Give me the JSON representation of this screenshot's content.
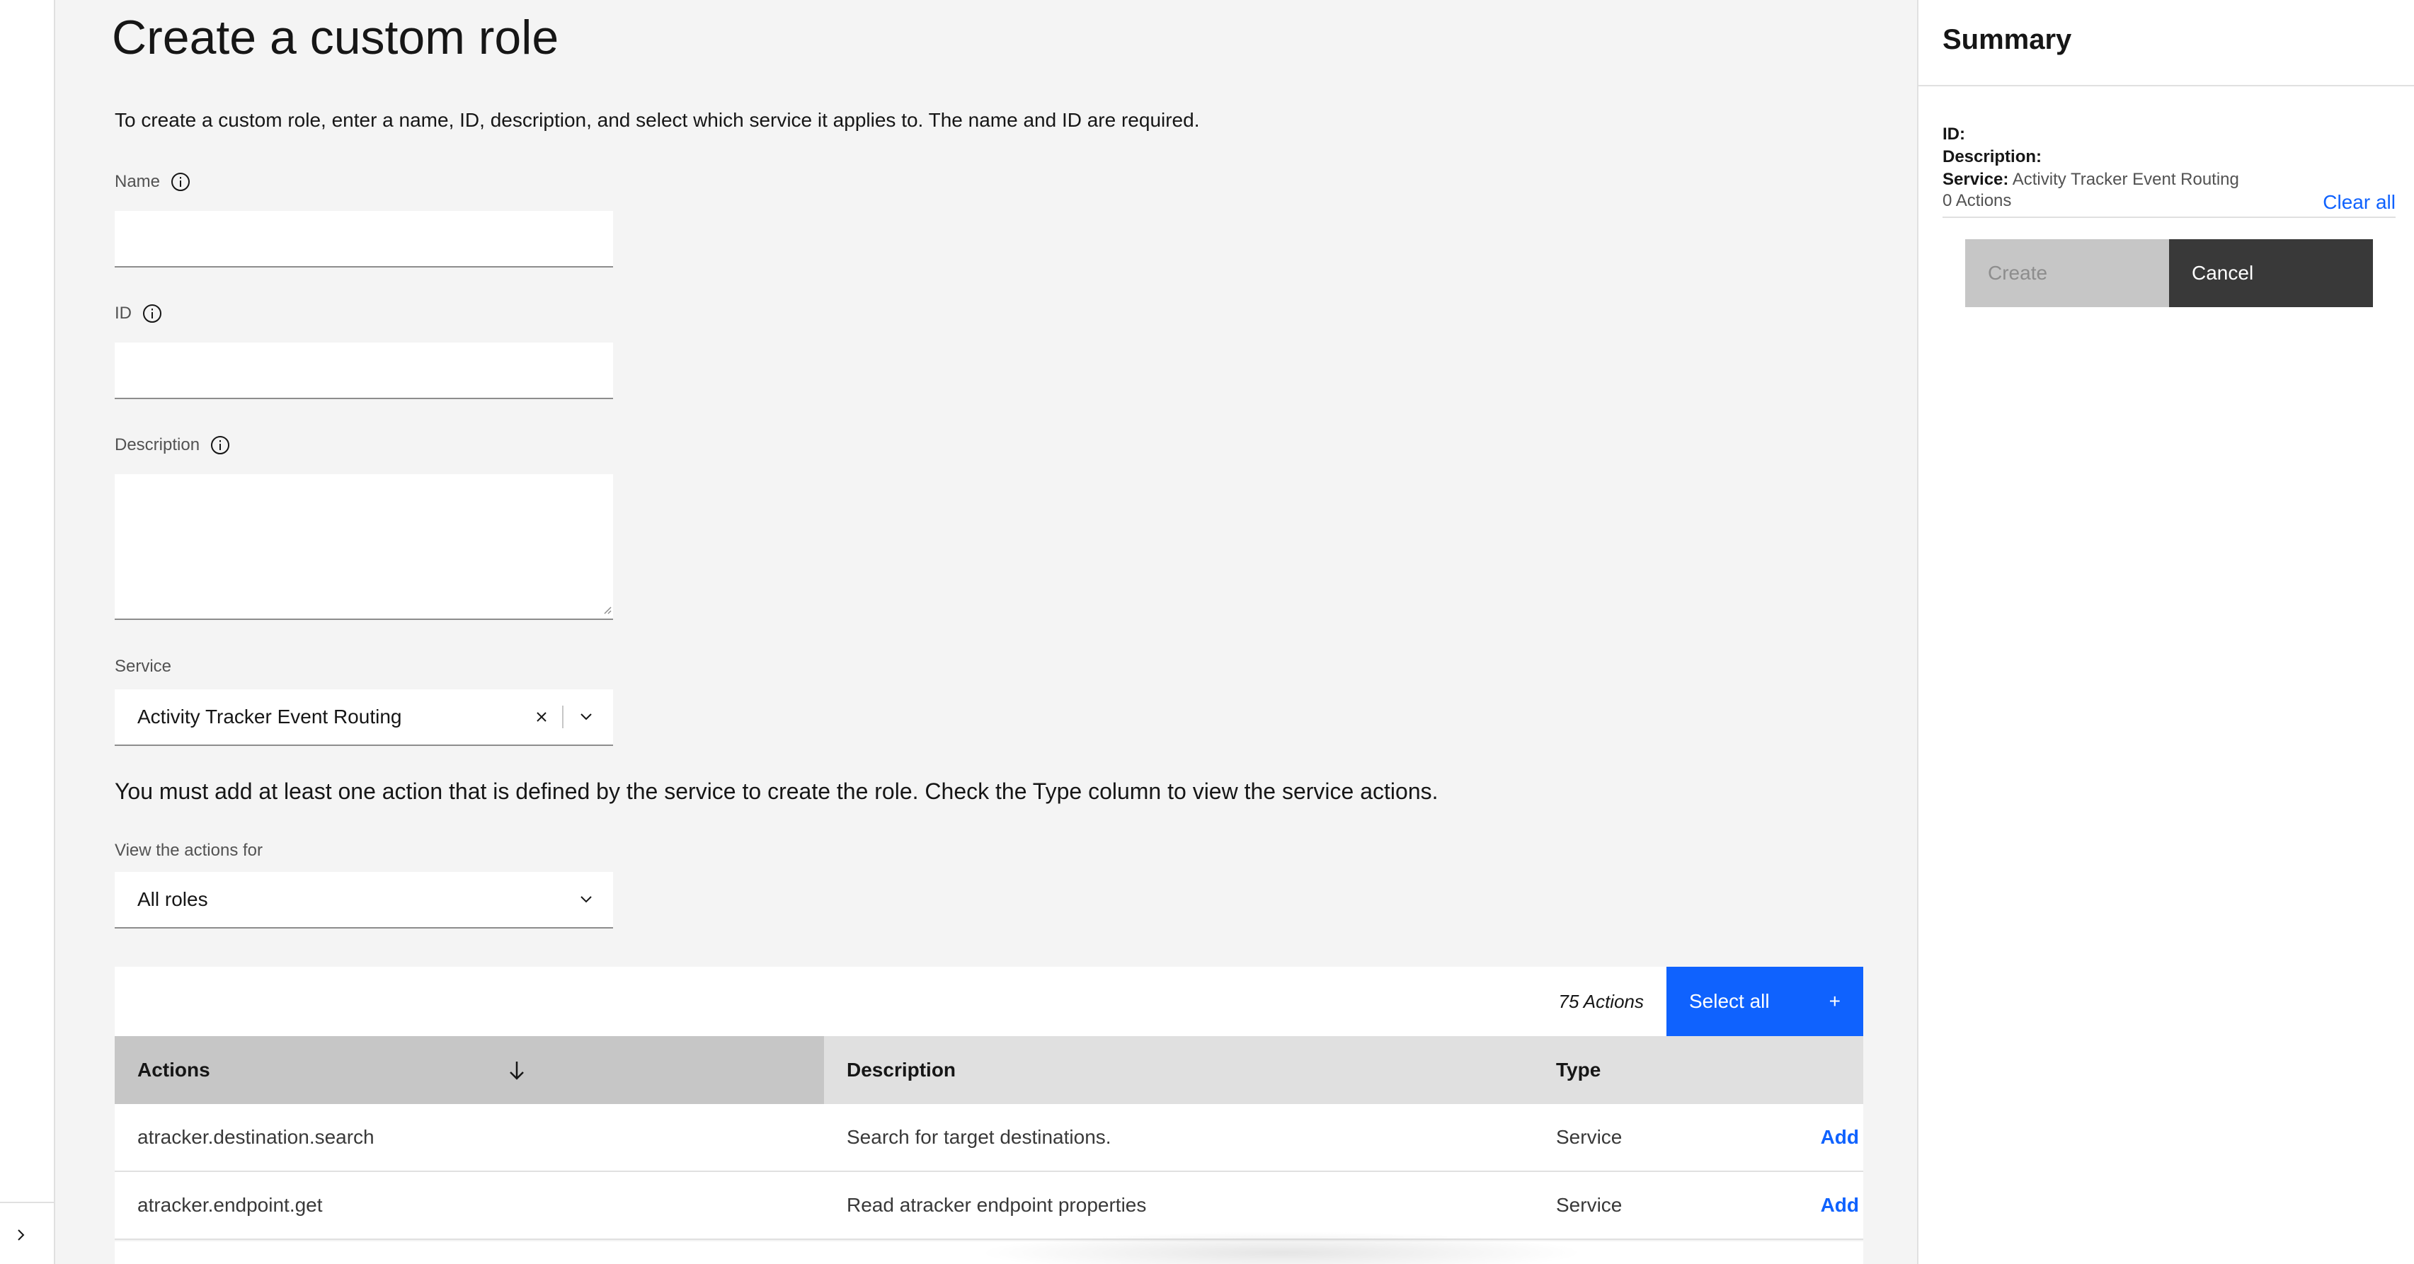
{
  "page": {
    "title": "Create a custom role",
    "intro": "To create a custom role, enter a name, ID, description, and select which service it applies to. The name and ID are required."
  },
  "form": {
    "name_label": "Name",
    "name_value": "",
    "id_label": "ID",
    "id_value": "",
    "description_label": "Description",
    "description_value": "",
    "service_label": "Service",
    "service_value": "Activity Tracker Event Routing",
    "notice": "You must add at least one action that is defined by the service to create the role. Check the Type column to view the service actions.",
    "view_label": "View the actions for",
    "view_value": "All roles"
  },
  "table": {
    "count_label": "75 Actions",
    "select_all_label": "Select all",
    "select_all_icon": "+",
    "headers": {
      "actions": "Actions",
      "description": "Description",
      "type": "Type"
    },
    "rows": [
      {
        "action": "atracker.destination.search",
        "description": "Search for target destinations.",
        "type": "Service",
        "add": "Add"
      },
      {
        "action": "atracker.endpoint.get",
        "description": "Read atracker endpoint properties",
        "type": "Service",
        "add": "Add"
      }
    ]
  },
  "summary": {
    "title": "Summary",
    "id_label": "ID:",
    "id_value": "",
    "description_label": "Description:",
    "description_value": "",
    "service_label": "Service:",
    "service_value": "Activity Tracker Event Routing",
    "actions_count": "0 Actions",
    "clear_all": "Clear all",
    "create_label": "Create",
    "cancel_label": "Cancel"
  },
  "icons": {
    "rail_expand": "chevron-right-icon",
    "info": "information-icon",
    "clear": "close-icon",
    "dropdown": "chevron-down-icon",
    "sort": "arrow-down-icon"
  },
  "colors": {
    "primary": "#0f62fe",
    "background": "#f4f4f4",
    "panel": "#ffffff",
    "header": "#e0e0e0",
    "header_active": "#c6c6c6",
    "secondary_button": "#393939"
  }
}
